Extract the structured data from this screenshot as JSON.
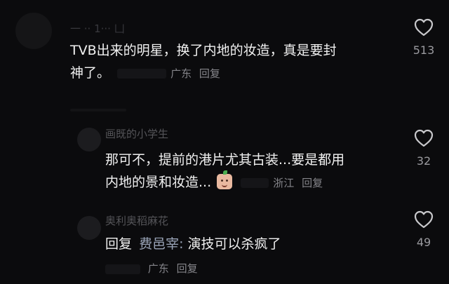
{
  "comments": [
    {
      "username": "一 ·· 1··· 凵",
      "text_line1": "TVB出来的明星，换了内地的妆造，真是要封",
      "text_line2": "神了。",
      "location": "广东",
      "reply_label": "回复",
      "like_count": "513"
    },
    {
      "username": "画既的小学生",
      "text_line1": "那可不，提前的港片尤其古装...要是都用",
      "text_line2": "内地的景和妆造...",
      "location": "浙江",
      "reply_label": "回复",
      "like_count": "32"
    },
    {
      "username": "奥利奥稻麻花",
      "reply_prefix": "回复",
      "reply_to": "费邑宰:",
      "text_line1": "演技可以杀疯了",
      "location": "广东",
      "reply_label": "回复",
      "like_count": "49"
    }
  ],
  "colors": {
    "background": "#0b0b0d",
    "text": "#f1f1f1",
    "meta": "#85858a",
    "mention": "#9aa4b8"
  },
  "icons": {
    "like": "heart-outline-icon",
    "emoji": "grinning-face-sticker-icon"
  }
}
